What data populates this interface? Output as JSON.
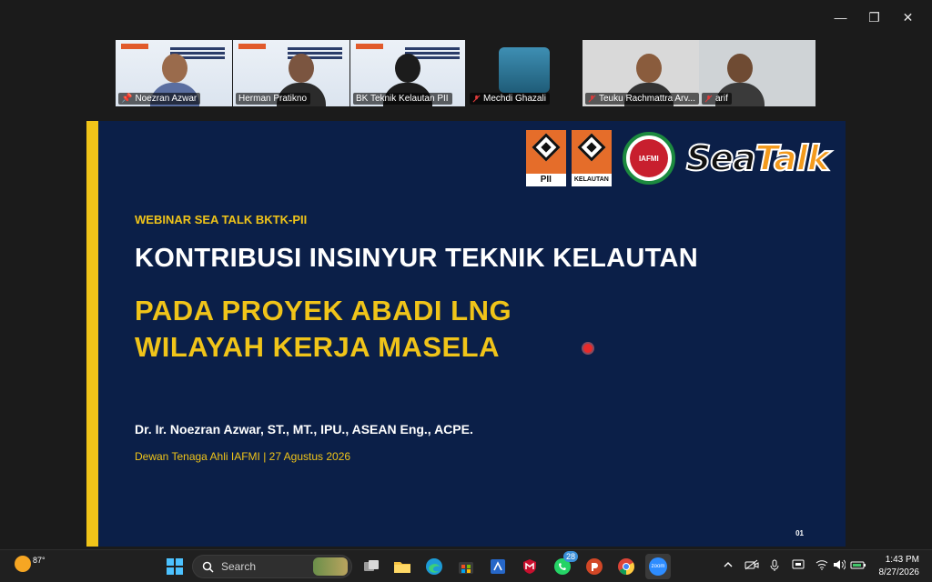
{
  "window": {
    "minimize_glyph": "—",
    "restore_glyph": "❐",
    "close_glyph": "✕"
  },
  "participants": [
    {
      "name": "Noezran Azwar",
      "pinned": true,
      "active": true
    },
    {
      "name": "Herman Pratikno",
      "pinned": false,
      "active": false
    },
    {
      "name": "BK Teknik Kelautan PII",
      "pinned": false,
      "active": false
    },
    {
      "name": "Mechdi Ghazali",
      "pinned": false,
      "active": false
    },
    {
      "name": "Teuku Rachmattra Arv...",
      "pinned": false,
      "active": false
    },
    {
      "name": "arif",
      "pinned": false,
      "active": false
    }
  ],
  "slide": {
    "logo_pii_label": "PII",
    "logo_kelautan_label": "KELAUTAN",
    "logo_iafmi_label": "IAFMI",
    "brand_sea": "Sea",
    "brand_talk": "Talk",
    "kicker": "WEBINAR SEA TALK BKTK-PII",
    "title_line1": "KONTRIBUSI INSINYUR TEKNIK KELAUTAN",
    "title_line2": "PADA PROYEK ABADI LNG",
    "title_line3": "WILAYAH KERJA MASELA",
    "presenter": "Dr. Ir. Noezran Azwar, ST., MT., IPU., ASEAN Eng., ACPE.",
    "role_date": "Dewan Tenaga Ahli IAFMI | 27 Agustus 2026",
    "page_number": "01",
    "colors": {
      "background": "#0b1f48",
      "accent": "#f0c419",
      "text": "#ffffff"
    }
  },
  "taskbar": {
    "weather_temp": "87°",
    "search_placeholder": "Search",
    "whatsapp_badge": "28",
    "zoom_label": "zoom",
    "clock_time": "1:43 PM",
    "clock_date": "8/27/2026"
  }
}
